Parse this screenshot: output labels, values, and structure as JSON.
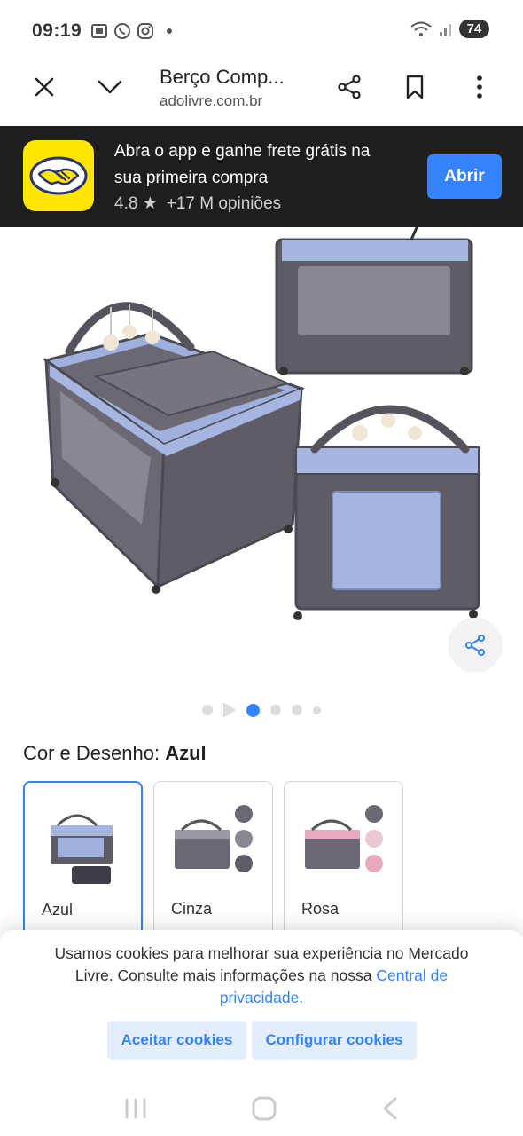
{
  "status_bar": {
    "time": "09:19",
    "battery": "74"
  },
  "browser": {
    "page_title": "Berço Comp...",
    "domain": "adolivre.com.br"
  },
  "app_banner": {
    "headline": "Abra o app e ganhe frete grátis na sua primeira compra",
    "rating": "4.8",
    "opinions": "+17 M opiniões",
    "open_label": "Abrir",
    "accent_color": "#3483fa",
    "logo_color": "#ffe600"
  },
  "gallery": {
    "total_dots": 6,
    "active_index": 2
  },
  "variant": {
    "label": "Cor e Desenho:",
    "selected": "Azul",
    "options": [
      {
        "label": "Azul"
      },
      {
        "label": "Cinza"
      },
      {
        "label": "Rosa"
      }
    ]
  },
  "cookies": {
    "text": "Usamos cookies para melhorar sua experiência no Mercado Livre. Consulte mais informações na nossa",
    "link": "Central de privacidade.",
    "accept_label": "Aceitar cookies",
    "configure_label": "Configurar cookies"
  }
}
